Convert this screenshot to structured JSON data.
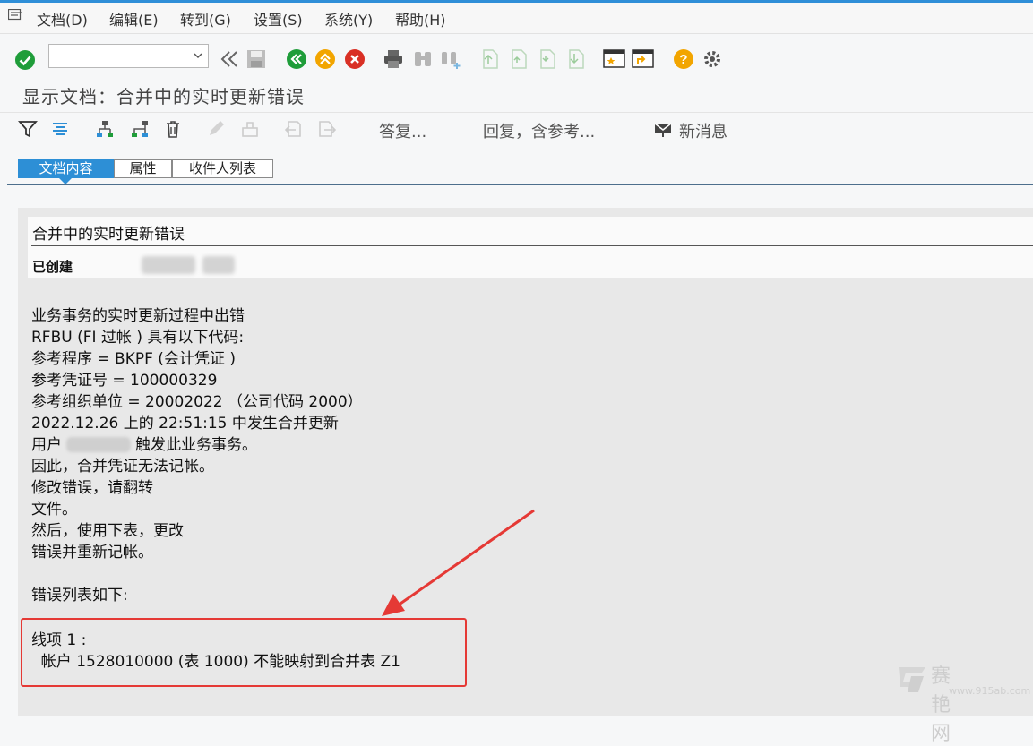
{
  "menubar": {
    "items": [
      "文档(D)",
      "编辑(E)",
      "转到(G)",
      "设置(S)",
      "系统(Y)",
      "帮助(H)"
    ]
  },
  "toolbar": {
    "command_field_value": ""
  },
  "page": {
    "title": "显示文档：合并中的实时更新错误"
  },
  "doc_toolbar": {
    "reply_label": "答复...",
    "reply_with_ref_label": "回复，含参考...",
    "new_message_label": "新消息"
  },
  "tabs": [
    {
      "label": "文档内容",
      "active": true
    },
    {
      "label": "属性",
      "active": false
    },
    {
      "label": "收件人列表",
      "active": false
    }
  ],
  "document": {
    "subject": "合并中的实时更新错误",
    "created_label": "已创建",
    "lines": [
      "业务事务的实时更新过程中出错",
      "RFBU (FI 过帐 ) 具有以下代码:",
      "参考程序 = BKPF (会计凭证 )",
      "参考凭证号 = 100000329",
      "参考组织单位 = 20002022 （公司代码 2000）",
      "2022.12.26 上的 22:51:15 中发生合并更新",
      "用户",
      "因此，合并凭证无法记帐。",
      "修改错误，请翻转",
      "文件。",
      "然后，使用下表，更改",
      "错误并重新记帐。",
      "",
      "错误列表如下:",
      "",
      "线项 1 :",
      "  帐户 1528010000 (表 1000) 不能映射到合并表 Z1"
    ],
    "user_line_suffix": "触发此业务事务。"
  },
  "watermark": {
    "brand": "赛 艳 网",
    "url": "www.915ab.com"
  },
  "colors": {
    "accent": "#2d8fd6",
    "highlight_box": "#e53935",
    "content_bg": "#e8e8e8"
  }
}
